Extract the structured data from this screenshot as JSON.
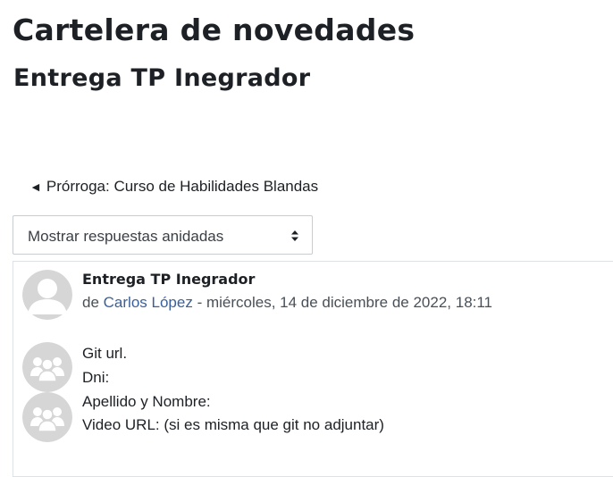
{
  "forum": {
    "title": "Cartelera de novedades"
  },
  "discussion": {
    "title": "Entrega TP Inegrador"
  },
  "navigation": {
    "prev_arrow": "◄",
    "prev_label": "Prórroga: Curso de Habilidades Blandas"
  },
  "display_mode": {
    "selected": "Mostrar respuestas anidadas",
    "icon": "updown-caret-icon"
  },
  "post": {
    "subject": "Entrega TP Inegrador",
    "by_prefix": "de",
    "author": "Carlos López",
    "separator": "-",
    "date": "miércoles, 14 de diciembre de 2022, 18:11",
    "avatar_icon": "user-avatar-icon",
    "group_icon": "group-icon",
    "body_lines": [
      "Git url.",
      "Dni:",
      "Apellido y Nombre:",
      "Video URL: (si es misma que git no adjuntar)"
    ]
  },
  "colors": {
    "link": "#3b5f9a",
    "text": "#1d2125",
    "border": "#dee2e6",
    "avatar_bg": "#d6d6d6"
  }
}
